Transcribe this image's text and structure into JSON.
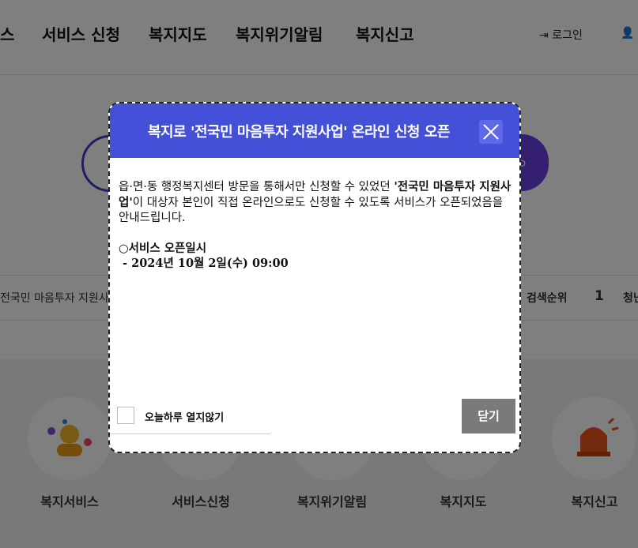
{
  "nav": {
    "items": [
      "스",
      "서비스 신청",
      "복지지도",
      "복지위기알림",
      "복지신고"
    ],
    "login": "로그인"
  },
  "popular": {
    "keyword_prefix": "전국민 마음투자 지원사",
    "rank_title": "검색순위",
    "rank_number": "1",
    "rank_keyword": "청닌"
  },
  "quick_menu": [
    {
      "label": "복지서비스",
      "icon": "person-icon"
    },
    {
      "label": "서비스신청",
      "icon": "application-icon"
    },
    {
      "label": "복지위기알림",
      "icon": "alert-icon"
    },
    {
      "label": "복지지도",
      "icon": "map-icon"
    },
    {
      "label": "복지신고",
      "icon": "siren-icon"
    }
  ],
  "modal": {
    "title": "복지로 '전국민 마음투자 지원사업' 온라인 신청 오픈",
    "body_part1": "읍·면·동 행정복지센터 방문을 통해서만 신청할 수 있었던 ",
    "body_bold": "'전국민 마음투자 지원사업'",
    "body_part2": "이 대상자 본인이 직접 온라인으로도 신청할 수 있도록 서비스가 오픈되었음을 안내드립니다.",
    "schedule_title": "○서비스 오픈일시",
    "schedule_value": " - 2024년 10월 2일(수) 09:00",
    "no_show_today": "오늘하루 열지않기",
    "close_label": "닫기"
  },
  "colors": {
    "header": "#4450d8",
    "accent": "#6a3fe0",
    "close_button": "#7a7a7a"
  }
}
